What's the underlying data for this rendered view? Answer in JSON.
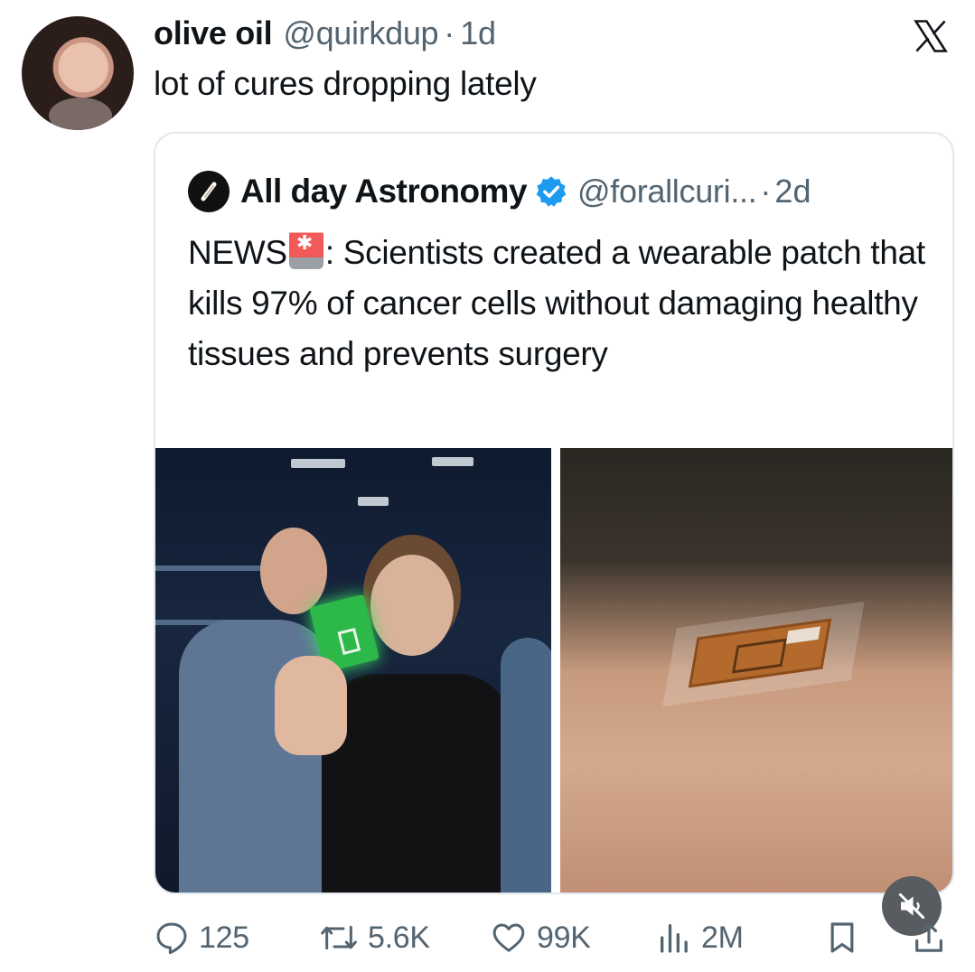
{
  "tweet": {
    "display_name": "olive oil",
    "handle": "@quirkdup",
    "separator": "·",
    "time": "1d",
    "text": "lot of cures dropping lately"
  },
  "quoted_tweet": {
    "display_name": "All day Astronomy",
    "handle": "@forallcuri...",
    "separator": "·",
    "time": "2d",
    "text_prefix": "NEWS",
    "text_body": ": Scientists created a wearable patch that kills 97% of cancer cells without damaging healthy tissues and prevents surgery"
  },
  "actions": {
    "replies": "125",
    "reposts": "5.6K",
    "likes": "99K",
    "views": "2M"
  },
  "icons": {
    "brand": "x-logo-icon",
    "verified": "verified-badge-icon",
    "siren": "siren-emoji-icon",
    "reply": "reply-icon",
    "repost": "repost-icon",
    "like": "heart-icon",
    "views": "views-chart-icon",
    "bookmark": "bookmark-icon",
    "share": "share-icon",
    "mute": "mute-icon"
  },
  "colors": {
    "text": "#0f1419",
    "secondary": "#536471",
    "verified": "#1d9bf0",
    "border": "#e1e8ed"
  }
}
